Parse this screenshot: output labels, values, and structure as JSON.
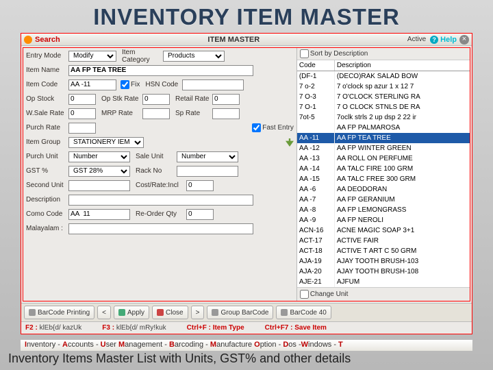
{
  "slide": {
    "title": "INVENTORY ITEM MASTER",
    "caption": "Inventory Items Master List with Units, GST% and other details"
  },
  "titlebar": {
    "search": "Search",
    "center": "ITEM  MASTER",
    "active": "Active",
    "help": "Help"
  },
  "labels": {
    "entry_mode": "Entry Mode",
    "item_category": "Item Category",
    "item_name": "Item Name",
    "item_code": "Item Code",
    "fix": "Fix",
    "hsn_code": "HSN Code",
    "op_stock": "Op Stock",
    "op_stk_rate": "Op Stk Rate",
    "retail_rate": "Retail Rate",
    "wsale_rate": "W.Sale Rate",
    "mrp_rate": "MRP Rate",
    "sp_rate": "Sp Rate",
    "purch_rate": "Purch Rate",
    "fast_entry": "Fast Entry",
    "item_group": "Item Group",
    "purch_unit": "Purch Unit",
    "sale_unit": "Sale Unit",
    "gst_pct": "GST %",
    "rack_no": "Rack No",
    "second_unit": "Second Unit",
    "cost_rate": "Cost/Rate:Incl",
    "description": "Description",
    "como_code": "Como Code",
    "reorder_qty": "Re-Order Qty",
    "malayalam": "Malayalam :",
    "sort_by_desc": "Sort by Description",
    "code_col": "Code",
    "desc_col": "Description",
    "change_unit": "Change Unit"
  },
  "form": {
    "entry_mode": "Modify",
    "item_category": "Products",
    "item_name": "AA FP TEA TREE",
    "item_code": "AA -11",
    "fix_checked": true,
    "hsn_code": "",
    "op_stock": "0",
    "op_stk_rate": "0",
    "retail_rate": "0",
    "wsale_rate": "0",
    "mrp_rate": "",
    "sp_rate": "",
    "purch_rate": "",
    "fast_entry_checked": true,
    "item_group": "STATIONERY IEM",
    "purch_unit": "Number",
    "sale_unit": "Number",
    "gst_pct": "GST 28%",
    "rack_no": "",
    "second_unit": "",
    "cost_rate": "0",
    "description": "",
    "como_code": "AA  11",
    "reorder_qty": "0",
    "malayalam": ""
  },
  "grid": {
    "sort_checked": false,
    "change_unit_checked": false,
    "rows": [
      {
        "code": "(DF-1",
        "desc": "(DECO)RAK SALAD BOW"
      },
      {
        "code": "7 o-2",
        "desc": "7 o'clock sp azur 1 x 12 7"
      },
      {
        "code": "7 O-3",
        "desc": "7 O'CLOCK STERLING RA"
      },
      {
        "code": "7 O-1",
        "desc": "7 O CLOCK STNLS DE RA"
      },
      {
        "code": "7ot-5",
        "desc": "7oclk strls 2 up dsp 2 22 ir"
      },
      {
        "code": "",
        "desc": "AA FP PALMAROSA"
      },
      {
        "code": "AA -11",
        "desc": "AA FP TEA TREE"
      },
      {
        "code": "AA -12",
        "desc": "AA FP WINTER GREEN"
      },
      {
        "code": "AA -13",
        "desc": "AA ROLL ON PERFUME"
      },
      {
        "code": "AA -14",
        "desc": "AA TALC FIRE 100 GRM"
      },
      {
        "code": "AA -15",
        "desc": "AA TALC FREE 300 GRM"
      },
      {
        "code": "AA -6",
        "desc": "AA DEODORAN"
      },
      {
        "code": "AA -7",
        "desc": "AA FP GERANIUM"
      },
      {
        "code": "AA -8",
        "desc": "AA FP LEMONGRASS"
      },
      {
        "code": "AA -9",
        "desc": "AA FP NEROLI"
      },
      {
        "code": "ACN-16",
        "desc": "ACNE MAGIC SOAP 3+1"
      },
      {
        "code": "ACT-17",
        "desc": "ACTIVE FAIR"
      },
      {
        "code": "ACT-18",
        "desc": "ACTIVE T ART C 50 GRM"
      },
      {
        "code": "AJA-19",
        "desc": "AJAY TOOTH BRUSH-103"
      },
      {
        "code": "AJA-20",
        "desc": "AJAY TOOTH BRUSH-108"
      },
      {
        "code": "AJE-21",
        "desc": "AJFUM"
      }
    ],
    "selected_index": 6
  },
  "toolbar": {
    "barcode_print": "BarCode Printing",
    "prev": "<",
    "apply": "Apply",
    "close": "Close",
    "next": ">",
    "group_barcode": "Group BarCode",
    "barcode40": "BarCode 40"
  },
  "hotkeys": {
    "f2": "F2 :",
    "f2_hint": "klEb{d/ kazUk",
    "f3": "F3 :",
    "f3_hint": "klEb{d/ mRy!kuk",
    "ctrf": "Ctrl+F : Item Type",
    "ctrf7": "Ctrl+F7 : Save Item"
  },
  "menu_strip": "Inventory - Accounts - User Management - Barcoding - Manufacture   Option - Dos -Windows - T"
}
